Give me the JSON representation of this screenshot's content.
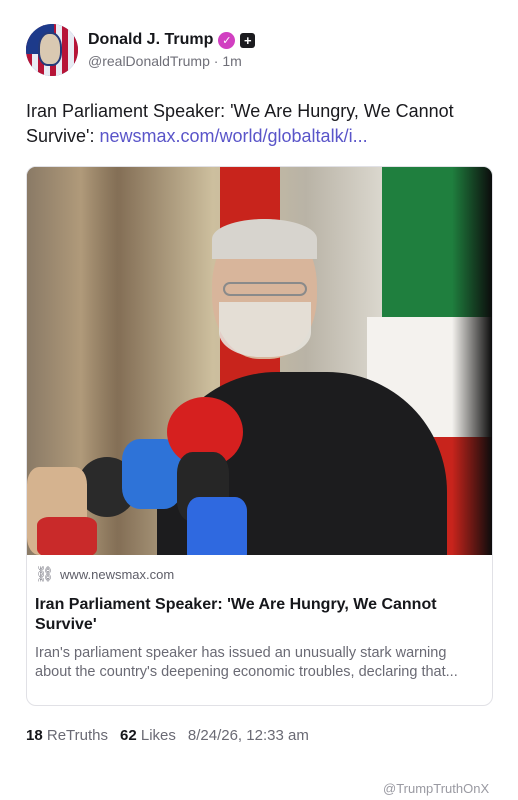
{
  "author": {
    "display_name": "Donald J. Trump",
    "handle": "@realDonaldTrump",
    "separator": "·",
    "time_ago": "1m",
    "verified_icon": "verified-badge-icon",
    "plus_icon": "plus-icon"
  },
  "post": {
    "text": "Iran Parliament Speaker: 'We Are Hungry, We Cannot Survive': ",
    "link_text": "newsmax.com/world/globaltalk/i..."
  },
  "link_card": {
    "domain": "www.newsmax.com",
    "title": "Iran Parliament Speaker: 'We Are Hungry, We Cannot Survive'",
    "description": "Iran's parliament speaker has issued an unusually stark warning about the country's deepening economic troubles, declaring that...",
    "link_icon": "link-chain-icon"
  },
  "stats": {
    "retruths_count": "18",
    "retruths_label": "ReTruths",
    "likes_count": "62",
    "likes_label": "Likes",
    "timestamp": "8/24/26, 12:33 am"
  },
  "watermark": "@TrumpTruthOnX",
  "colors": {
    "link": "#5a55c9",
    "verified": "#d13fc1",
    "muted": "#6a6a74"
  }
}
